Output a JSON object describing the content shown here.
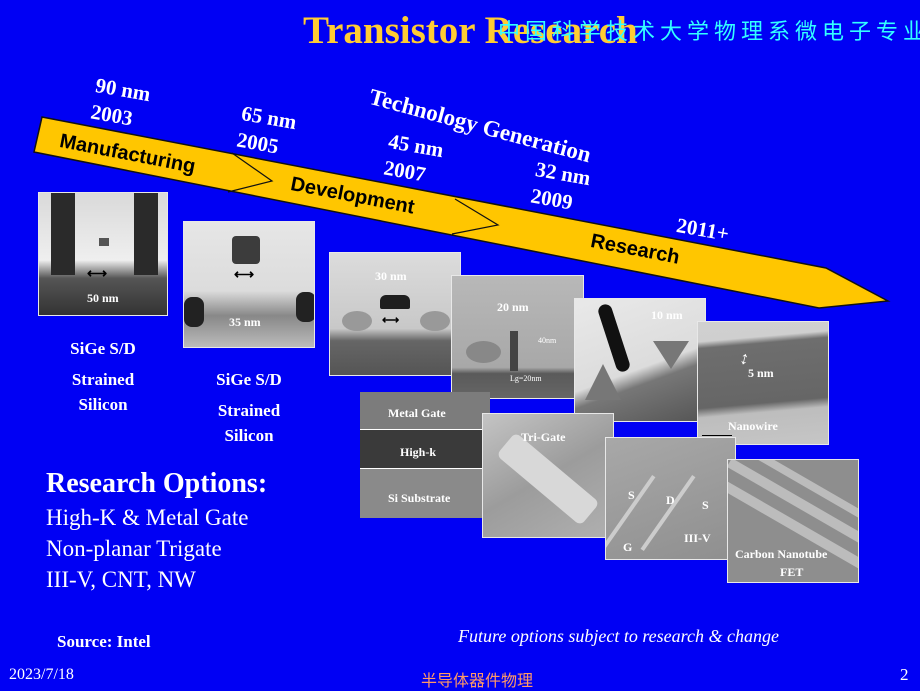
{
  "slide": {
    "title": "Transistor Research",
    "banner": "中国科学技术大学物理系微电子专业",
    "technology_label": "Technology Generation",
    "generations": [
      {
        "node": "90 nm",
        "year": "2003"
      },
      {
        "node": "65 nm",
        "year": "2005"
      },
      {
        "node": "45 nm",
        "year": "2007"
      },
      {
        "node": "32 nm",
        "year": "2009"
      },
      {
        "node": "",
        "year": "2011+"
      }
    ],
    "stages": [
      "Manufacturing",
      "Development",
      "Research"
    ],
    "colors": {
      "background": "#0000f4",
      "arrow": "#ffc600",
      "title": "#ffcc33",
      "banner": "#33ffff",
      "footer_course": "#ff9966"
    },
    "images": [
      {
        "label": "50 nm",
        "kind": "TEM cross-section"
      },
      {
        "label": "35 nm",
        "kind": "TEM cross-section"
      },
      {
        "label": "30 nm",
        "kind": "TEM cross-section"
      },
      {
        "label": "20 nm",
        "kind": "TEM cross-section",
        "annot_height": "40nm",
        "annot_lg": "Lg=20nm"
      },
      {
        "label": "10 nm",
        "kind": "TEM cross-section"
      },
      {
        "label": "5 nm",
        "caption": "Nanowire",
        "kind": "TEM nanowire"
      },
      {
        "layers": [
          "Metal Gate",
          "High-k",
          "Si Substrate"
        ],
        "kind": "gate stack"
      },
      {
        "label": "Tri-Gate",
        "kind": "SEM"
      },
      {
        "labels": [
          "S",
          "D",
          "S",
          "G",
          "III-V"
        ],
        "kind": "SEM"
      },
      {
        "label": "Carbon Nanotube",
        "label2": "FET",
        "kind": "SEM"
      }
    ],
    "captions": [
      {
        "line1": "SiGe S/D",
        "line2": "Strained",
        "line3": "Silicon"
      },
      {
        "line1": "SiGe S/D",
        "line2": "Strained",
        "line3": "Silicon"
      }
    ],
    "research_options": {
      "title": "Research Options:",
      "items": [
        "High-K & Metal Gate",
        "Non-planar Trigate",
        "III-V, CNT, NW"
      ]
    },
    "source": "Source:  Intel",
    "note": "Future options subject to research & change"
  },
  "footer": {
    "date": "2023/7/18",
    "course": "半导体器件物理",
    "page": "2"
  }
}
